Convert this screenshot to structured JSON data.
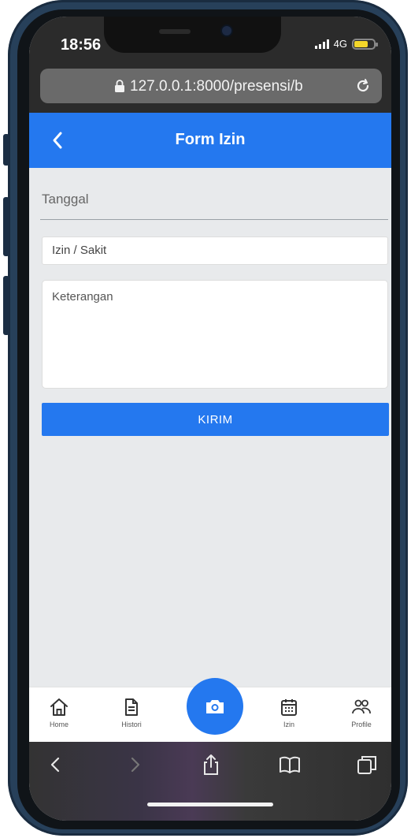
{
  "status": {
    "time": "18:56",
    "network": "4G"
  },
  "browser": {
    "url": "127.0.0.1:8000/presensi/b"
  },
  "appbar": {
    "title": "Form Izin"
  },
  "form": {
    "date_label": "Tanggal",
    "type_value": "Izin / Sakit",
    "note_placeholder": "Keterangan",
    "submit_label": "KIRIM"
  },
  "nav": {
    "items": [
      {
        "label": "Home",
        "icon": "home-icon"
      },
      {
        "label": "Histori",
        "icon": "document-icon"
      },
      {
        "label": "",
        "icon": "camera-icon"
      },
      {
        "label": "Izin",
        "icon": "calendar-icon"
      },
      {
        "label": "Profile",
        "icon": "users-icon"
      }
    ]
  },
  "colors": {
    "primary": "#2478ef",
    "background": "#e8eaec"
  }
}
